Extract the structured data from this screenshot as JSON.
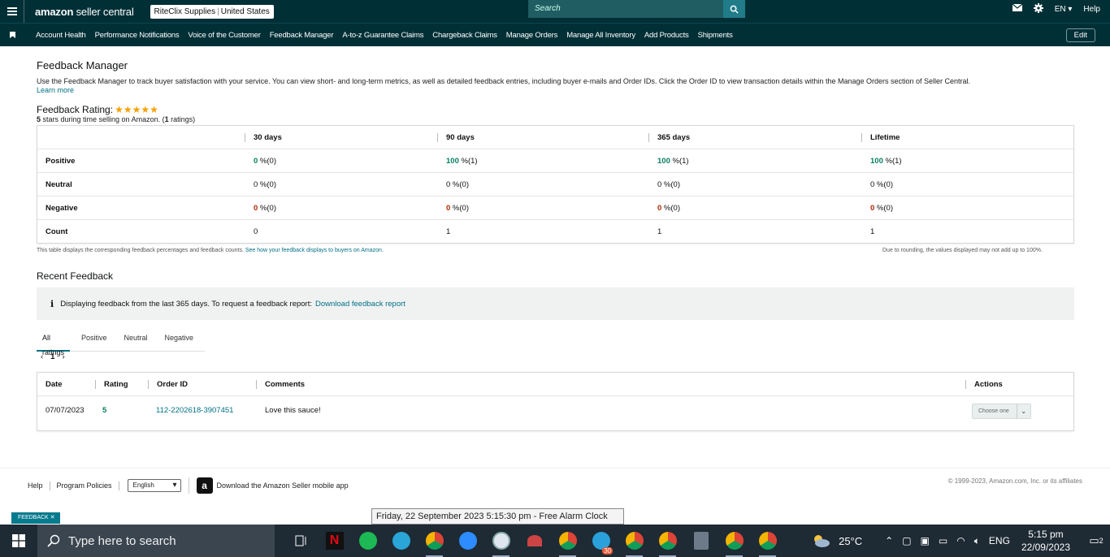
{
  "header": {
    "logo_prefix": "amazon",
    "logo_suffix": " seller central",
    "store_name": "RiteClix Supplies",
    "store_country": "United States",
    "search_placeholder": "Search",
    "language": "EN",
    "help": "Help"
  },
  "nav": {
    "items": [
      "Account Health",
      "Performance Notifications",
      "Voice of the Customer",
      "Feedback Manager",
      "A-to-z Guarantee Claims",
      "Chargeback Claims",
      "Manage Orders",
      "Manage All Inventory",
      "Add Products",
      "Shipments"
    ],
    "edit": "Edit"
  },
  "page": {
    "title": "Feedback Manager",
    "intro": "Use the Feedback Manager to track buyer satisfaction with your service. You can view short- and long-term metrics, as well as detailed feedback entries, including buyer e-mails and Order IDs. Click the Order ID to view transaction details within the Manage Orders section of Seller Central.",
    "learn_more": "Learn more",
    "rating_label": "Feedback Rating:",
    "stars": "★★★★★",
    "rating_stars_value": "5",
    "rating_sub_1": " stars during time selling on Amazon. (",
    "rating_count": "1",
    "rating_sub_2": " ratings)"
  },
  "metrics": {
    "headers": [
      "30 days",
      "90 days",
      "365 days",
      "Lifetime"
    ],
    "rows": [
      {
        "label": "Positive",
        "cells": [
          {
            "v": "0",
            "s": " %(0)"
          },
          {
            "v": "100",
            "s": " %(1)"
          },
          {
            "v": "100",
            "s": " %(1)"
          },
          {
            "v": "100",
            "s": " %(1)"
          }
        ]
      },
      {
        "label": "Neutral",
        "cells": [
          {
            "v": "",
            "s": "0 %(0)"
          },
          {
            "v": "",
            "s": "0 %(0)"
          },
          {
            "v": "",
            "s": "0 %(0)"
          },
          {
            "v": "",
            "s": "0 %(0)"
          }
        ]
      },
      {
        "label": "Negative",
        "cells": [
          {
            "v": "0",
            "s": " %(0)"
          },
          {
            "v": "0",
            "s": " %(0)"
          },
          {
            "v": "0",
            "s": " %(0)"
          },
          {
            "v": "0",
            "s": " %(0)"
          }
        ]
      },
      {
        "label": "Count",
        "cells": [
          {
            "v": "",
            "s": "0"
          },
          {
            "v": "",
            "s": "1"
          },
          {
            "v": "",
            "s": "1"
          },
          {
            "v": "",
            "s": "1"
          }
        ]
      }
    ],
    "footnote_left": "This table displays the corresponding feedback percentages and feedback counts. ",
    "footnote_link": "See how your feedback displays to buyers on Amazon.",
    "footnote_right": "Due to rounding, the values displayed may not add up to 100%."
  },
  "recent": {
    "title": "Recent Feedback",
    "info_icon": "i",
    "info_text": "Displaying feedback from the last 365 days. To request a feedback report:",
    "info_link": "Download feedback report",
    "tabs": [
      "All ratings",
      "Positive",
      "Neutral",
      "Negative"
    ],
    "pager_prev": "‹",
    "pager_page": "1",
    "pager_next": "›",
    "columns": [
      "Date",
      "Rating",
      "Order ID",
      "Comments",
      "Actions"
    ],
    "rows": [
      {
        "date": "07/07/2023",
        "rating": "5",
        "order_id": "112-2202618-3907451",
        "comment": "Love this sauce!",
        "action": "Choose one"
      }
    ]
  },
  "footer": {
    "links": [
      "Help",
      "Program Policies"
    ],
    "language": "English",
    "app_icon": "a",
    "app_text": "Download the Amazon Seller mobile app",
    "copyright": "© 1999-2023, Amazon.com, Inc. or its affiliates",
    "feedback_tab": "FEEDBACK ✕"
  },
  "tooltip": "Friday, 22 September 2023 5:15:30 pm - Free Alarm Clock",
  "taskbar": {
    "search_placeholder": "Type here to search",
    "temperature": "25°C",
    "lang": "ENG",
    "time": "5:15 pm",
    "date": "22/09/2023",
    "notifications": "2",
    "telegram_badge": "30"
  }
}
